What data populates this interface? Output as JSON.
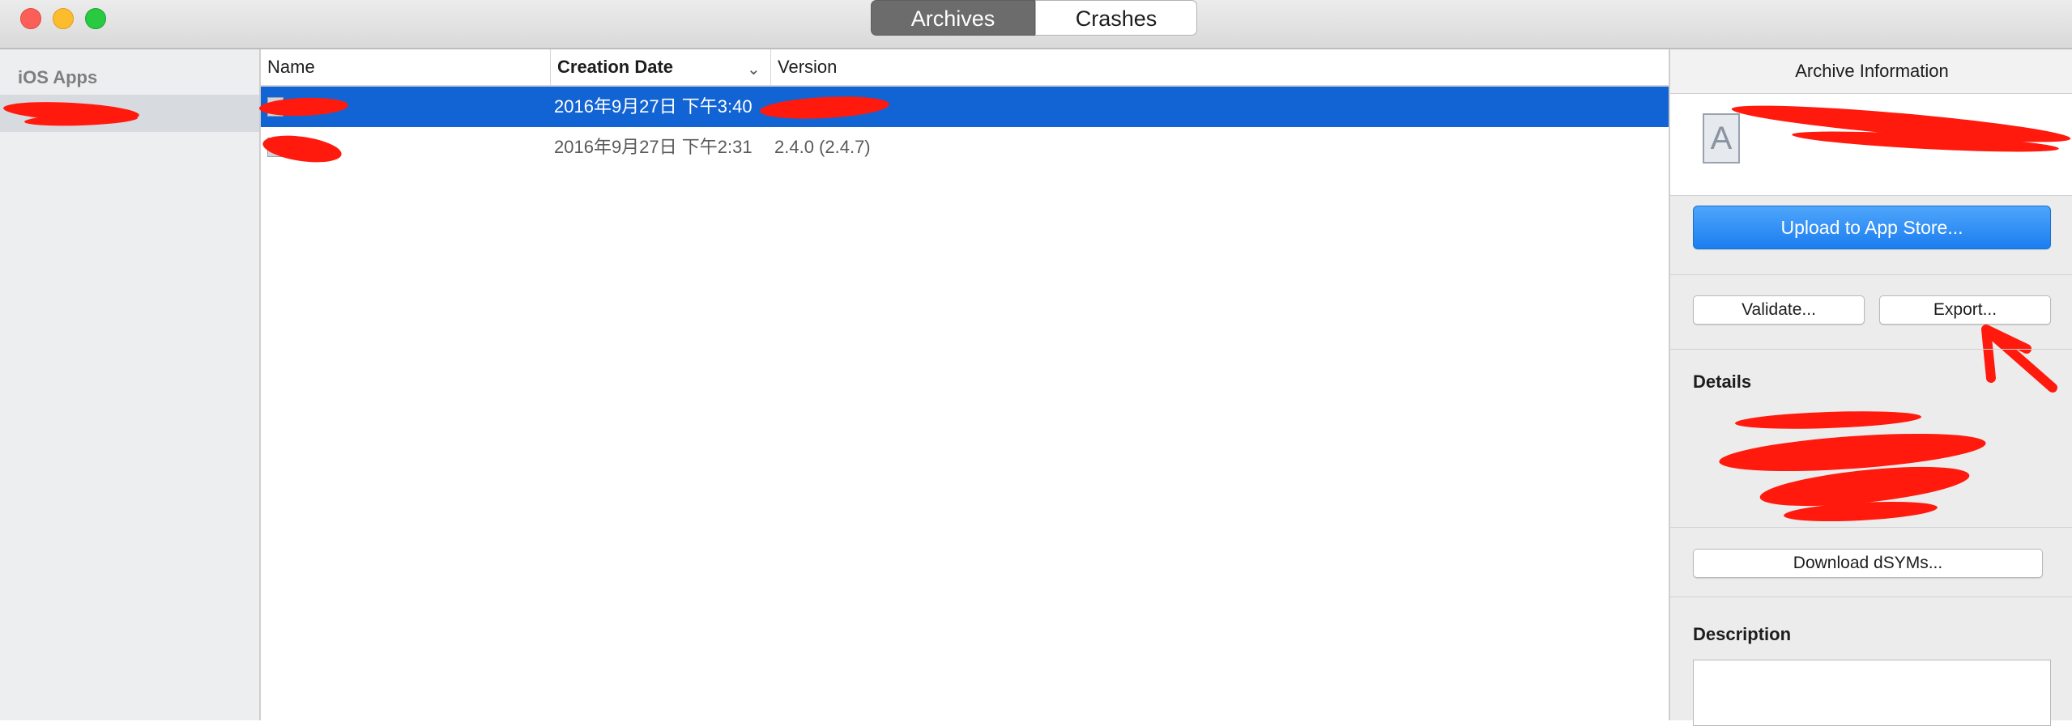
{
  "window": {
    "segments": [
      "Archives",
      "Crashes"
    ],
    "active_segment": "Archives"
  },
  "sidebar": {
    "heading": "iOS Apps"
  },
  "table": {
    "columns": [
      "Name",
      "Creation Date",
      "Version"
    ],
    "sorted_column": "Creation Date",
    "rows": [
      {
        "name": "",
        "date": "2016年9月27日 下午3:40",
        "version": "",
        "selected": true
      },
      {
        "name": "",
        "date": "2016年9月27日 下午2:31",
        "version": "2.4.0 (2.4.7)",
        "selected": false
      }
    ]
  },
  "inspector": {
    "title": "Archive Information",
    "upload_label": "Upload to App Store...",
    "validate_label": "Validate...",
    "export_label": "Export...",
    "details_heading": "Details",
    "dsyms_label": "Download dSYMs...",
    "description_heading": "Description"
  },
  "colors": {
    "selection": "#1264d4",
    "upload_button": "#1b7ef0",
    "redaction": "#ff1a0d"
  }
}
